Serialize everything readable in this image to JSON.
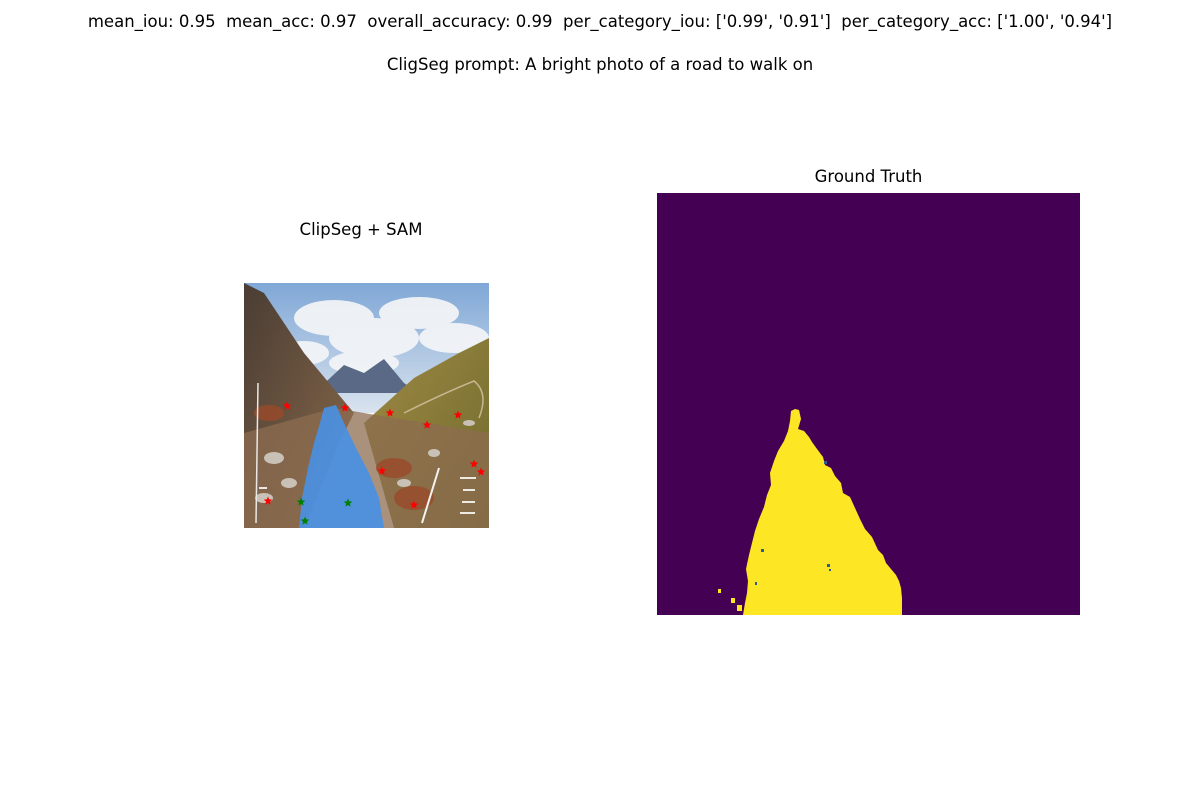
{
  "header": {
    "metrics_line": "mean_iou: 0.95  mean_acc: 0.97  overall_accuracy: 0.99  per_category_iou: ['0.99', '0.91']  per_category_acc: ['1.00', '0.94']",
    "prompt_line": "CligSeg prompt: A bright photo of a road to walk on"
  },
  "panels": {
    "left": {
      "title": "ClipSeg + SAM",
      "overlay_color": "#4a90e2",
      "negative_point_color": "#ff0000",
      "positive_point_color": "#008000"
    },
    "right": {
      "title": "Ground Truth",
      "background_color": "#440154",
      "foreground_color": "#fde725"
    }
  }
}
